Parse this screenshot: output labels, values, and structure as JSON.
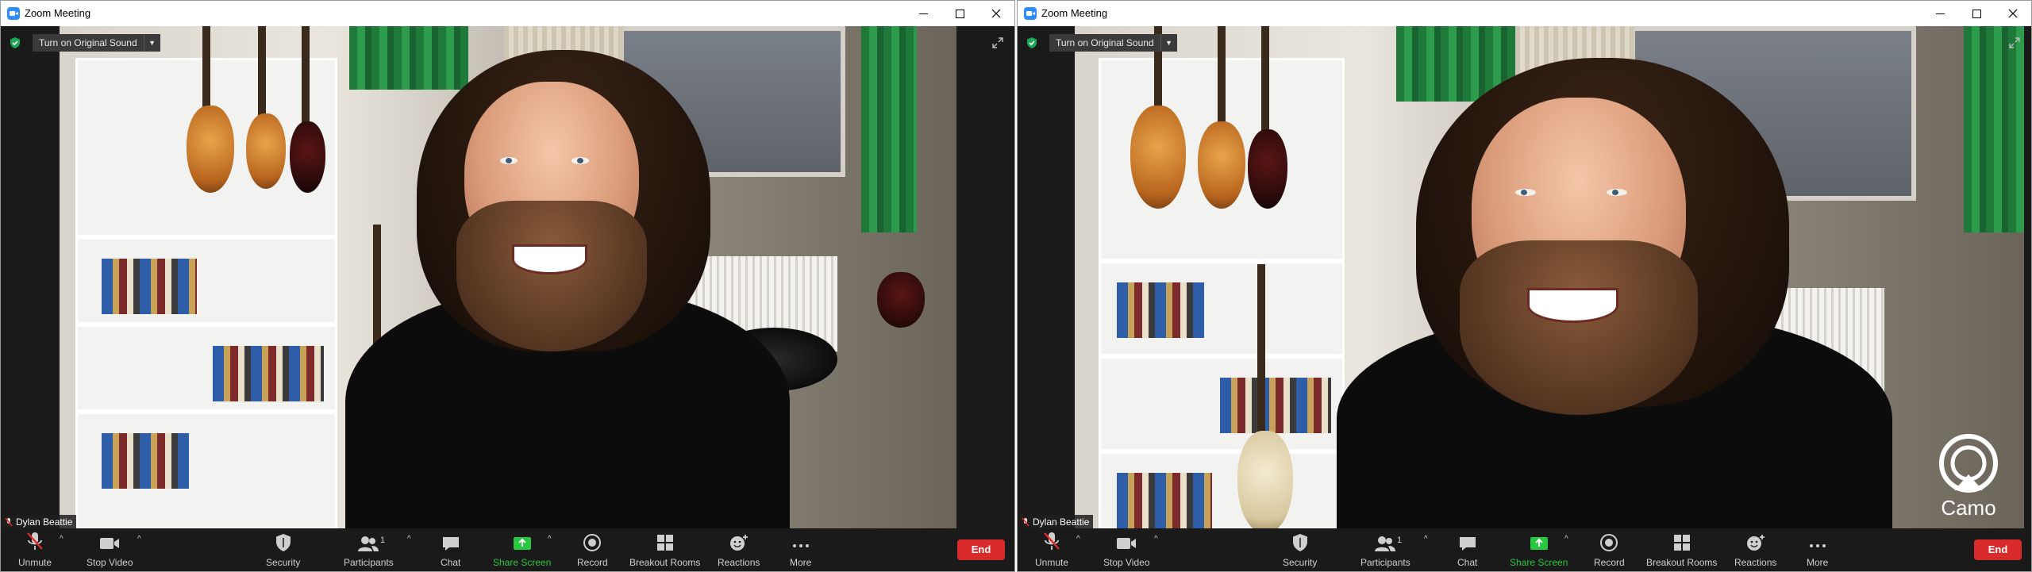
{
  "colors": {
    "toolbar_bg": "#1a1a1a",
    "end_button": "#d92b2b",
    "share_screen_green": "#28c840",
    "zoom_blue": "#2d8cff",
    "security_shield_green": "#1ea656"
  },
  "windows": [
    {
      "title": "Zoom Meeting",
      "original_sound_label": "Turn on Original Sound",
      "participant_name": "Dylan Beattie",
      "toolbar": {
        "unmute": "Unmute",
        "stop_video": "Stop Video",
        "security": "Security",
        "participants": "Participants",
        "participants_count": "1",
        "chat": "Chat",
        "share_screen": "Share Screen",
        "record": "Record",
        "breakout_rooms": "Breakout Rooms",
        "reactions": "Reactions",
        "more": "More",
        "end": "End"
      }
    },
    {
      "title": "Zoom Meeting",
      "original_sound_label": "Turn on Original Sound",
      "participant_name": "Dylan Beattie",
      "watermark": "Camo",
      "toolbar": {
        "unmute": "Unmute",
        "stop_video": "Stop Video",
        "security": "Security",
        "participants": "Participants",
        "participants_count": "1",
        "chat": "Chat",
        "share_screen": "Share Screen",
        "record": "Record",
        "breakout_rooms": "Breakout Rooms",
        "reactions": "Reactions",
        "more": "More",
        "end": "End"
      }
    }
  ]
}
